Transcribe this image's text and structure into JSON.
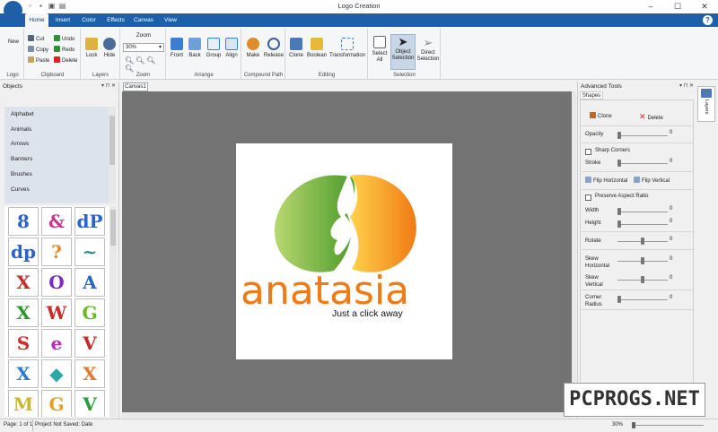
{
  "window": {
    "title": "Logo Creation",
    "minimize": "–",
    "maximize": "☐",
    "close": "✕"
  },
  "ribbon_tabs": [
    "Home",
    "Insert",
    "Color",
    "Effects",
    "Canvas",
    "View"
  ],
  "help": "?",
  "ribbon": {
    "new_label": "New",
    "logo_group": "Logo",
    "clipboard": {
      "cut": "Cut",
      "copy": "Copy",
      "paste": "Paste",
      "undo": "Undo",
      "redo": "Redo",
      "delete": "Delete",
      "label": "Clipboard"
    },
    "layers": {
      "lock": "Lock",
      "hide": "Hide",
      "label": "Layers"
    },
    "zoom": {
      "title": "Zoom",
      "value": "30%",
      "label": "Zoom"
    },
    "arrange": {
      "front": "Front",
      "back": "Back",
      "group": "Group",
      "align": "Align",
      "label": "Arrange"
    },
    "compound": {
      "make": "Make",
      "release": "Release",
      "label": "Compound Path"
    },
    "editing": {
      "clone": "Clone",
      "boolean": "Boolean",
      "transformation": "Transformation",
      "label": "Editing"
    },
    "selection": {
      "select_all_1": "Select",
      "select_all_2": "All",
      "object_1": "Object",
      "object_2": "Selection",
      "direct_1": "Direct",
      "direct_2": "Selection",
      "label": "Selection"
    }
  },
  "objects_panel": {
    "title": "Objects",
    "categories": [
      "Alphabet",
      "Animals",
      "Arrows",
      "Banners",
      "Brushes",
      "Curves"
    ],
    "glyphs": [
      "8",
      "&",
      "dP",
      "dp",
      "?",
      "~",
      "X",
      "O",
      "A",
      "X",
      "W",
      "G",
      "S",
      "e",
      "V",
      "X",
      "◆",
      "X",
      "M",
      "G",
      "V"
    ]
  },
  "canvas": {
    "tab": "Canvas1",
    "brand": "anatasia",
    "tagline": "Just a click away"
  },
  "advanced": {
    "title": "Advanced Tools",
    "tab": "Shapes",
    "clone": "Clone",
    "delete": "Delete",
    "opacity": "Opacity",
    "opacity_val": "0",
    "sharp": "Sharp Corners",
    "stroke": "Stroke",
    "stroke_val": "0",
    "flip_h": "Flip Horizontal",
    "flip_v": "Flip Vertical",
    "preserve": "Preserve Aspect Ratio",
    "width": "Width",
    "width_val": "0",
    "height": "Height",
    "height_val": "0",
    "rotate": "Rotate",
    "rotate_val": "0",
    "skew_h1": "Skew",
    "skew_h2": "Horizontal",
    "skew_h_val": "0",
    "skew_v1": "Skew",
    "skew_v2": "Vertical",
    "skew_v_val": "0",
    "corner1": "Corner",
    "corner2": "Radius",
    "corner_val": "0",
    "layers_tab": "Layers"
  },
  "status": {
    "page": "Page: 1 of 1",
    "saved": "Project Not Saved: Date",
    "zoom": "30%"
  },
  "watermark": "PCPROGS.NET"
}
